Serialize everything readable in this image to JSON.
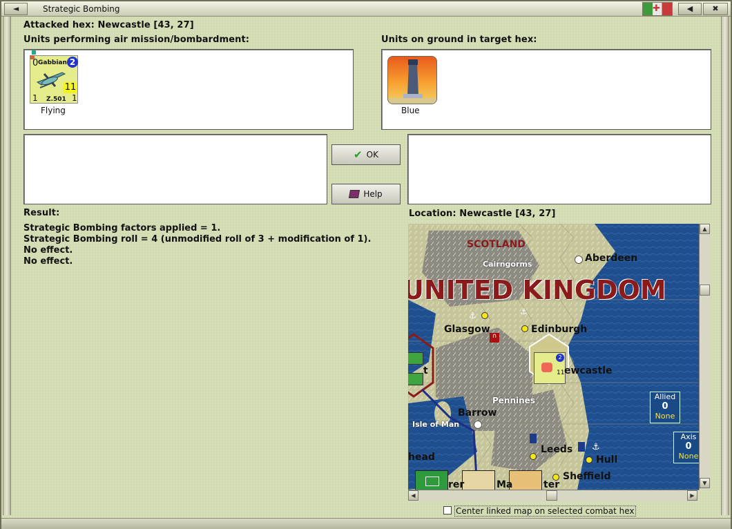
{
  "window": {
    "title": "Strategic Bombing"
  },
  "header": {
    "attacked_hex": "Attacked hex: Newcastle  [43, 27]"
  },
  "air_units": {
    "label": "Units performing air mission/bombardment:",
    "unit": {
      "name": "Gabbiano",
      "designation": "Z.501",
      "range": "2",
      "top_left": "0",
      "strength": "11",
      "bottom_left": "1",
      "bottom_right": "1",
      "status": "Flying"
    }
  },
  "ground_units": {
    "label": "Units on ground in target hex:",
    "unit": {
      "status": "Blue"
    }
  },
  "buttons": {
    "ok": "OK",
    "help": "Help"
  },
  "result": {
    "label": "Result:",
    "lines": [
      "Strategic Bombing factors applied = 1.",
      "Strategic Bombing roll = 4 (unmodified roll of 3 + modification of 1).",
      "No effect.",
      "No effect."
    ]
  },
  "location": {
    "label": "Location:  Newcastle  [43, 27]"
  },
  "map": {
    "country": "UNITED KINGDOM",
    "region": "SCOTLAND",
    "places": {
      "cairngorms": "Cairngorms",
      "aberdeen": "Aberdeen",
      "glasgow": "Glasgow",
      "edinburgh": "Edinburgh",
      "newcastle": "ewcastle",
      "pennines": "Pennines",
      "barrow": "Barrow",
      "isle_of_man": "Isle of Man",
      "leeds": "Leeds",
      "hull": "Hull",
      "sheffield": "Sheffield",
      "head": "head",
      "ter": "ter",
      "ma": "Ma",
      "rer": "rer",
      "t": "t"
    },
    "allied_box": {
      "title": "Allied",
      "value": "0",
      "status": "None"
    },
    "axis_box": {
      "title": "Axis",
      "value": "0",
      "status": "None"
    }
  },
  "footer": {
    "checkbox_label": "Center linked map on selected combat hex",
    "checked": false
  },
  "colors": {
    "background": "#d2dbb2",
    "sea": "#1e4d8c",
    "land": "#c9c9a0",
    "accent_red": "#8b1a1a"
  }
}
